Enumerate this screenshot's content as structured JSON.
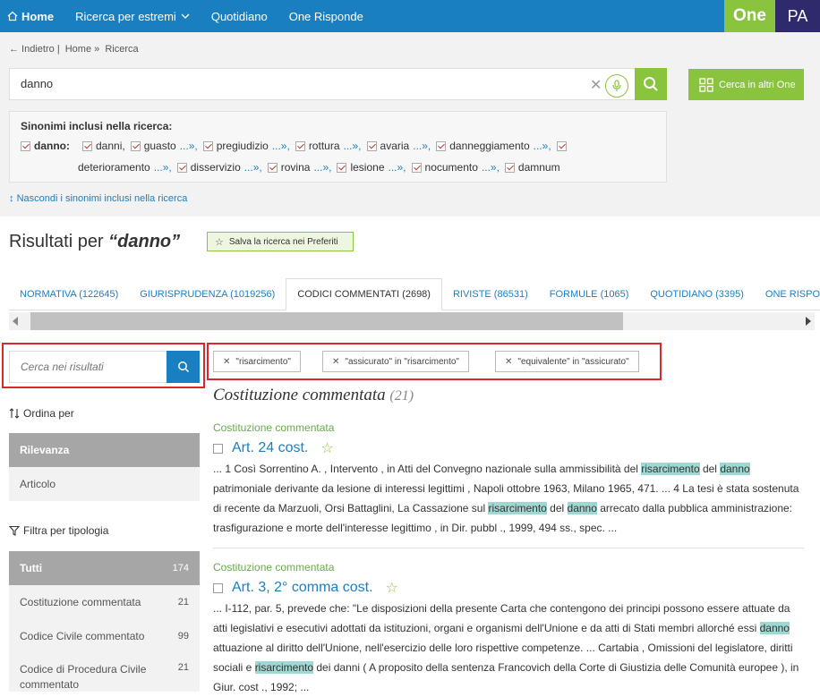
{
  "topnav": {
    "home": "Home",
    "ricerca": "Ricerca per estremi",
    "quotidiano": "Quotidiano",
    "one_risponde": "One Risponde",
    "one_badge": "One",
    "pa_badge": "PA"
  },
  "breadcrumb": {
    "back": "← Indietro",
    "sep": "|",
    "home": "Home",
    "arrow": "»",
    "current": "Ricerca"
  },
  "search": {
    "value": "danno",
    "button_altri": "Cerca in altri One"
  },
  "synonyms": {
    "title": "Sinonimi inclusi nella ricerca:",
    "term": "danno:",
    "line1": [
      "danni,",
      "guasto",
      "pregiudizio",
      "rottura",
      "avaria",
      "danneggiamento"
    ],
    "line2": [
      "deterioramento",
      "disservizio",
      "rovina",
      "lesione",
      "nocumento",
      "damnum"
    ],
    "more": "...»,",
    "hide": "Nascondi i sinonimi inclusi nella ricerca"
  },
  "results_header": {
    "prefix": "Risultati per ",
    "term": "“danno”",
    "save": "Salva la ricerca nei Preferiti"
  },
  "tabs": [
    "NORMATIVA (122645)",
    "GIURISPRUDENZA (1019256)",
    "CODICI COMMENTATI (2698)",
    "RIVISTE (86531)",
    "FORMULE (1065)",
    "QUOTIDIANO (3395)",
    "ONE RISPONDE"
  ],
  "sidebar": {
    "filter_placeholder": "Cerca nei risultati",
    "sort_label": "Ordina per",
    "sort_options": [
      "Rilevanza",
      "Articolo"
    ],
    "type_label": "Filtra per tipologia",
    "types": [
      {
        "name": "Tutti",
        "count": "174"
      },
      {
        "name": "Costituzione commentata",
        "count": "21"
      },
      {
        "name": "Codice Civile commentato",
        "count": "99"
      },
      {
        "name": "Codice di Procedura Civile commentato",
        "count": "21"
      }
    ]
  },
  "chips": [
    "\"risarcimento\"",
    "\"assicurato\" in \"risarcimento\"",
    "\"equivalente\" in \"assicurato\""
  ],
  "section": {
    "title": "Costituzione commentata",
    "count": "(21)"
  },
  "results": [
    {
      "type": "Costituzione commentata",
      "title": "Art. 24 cost.",
      "snippet_parts": [
        "... 1 Così Sorrentino A. , Intervento , in Atti del Convegno nazionale sulla ammissibilità del ",
        "risarcimento",
        " del ",
        "danno",
        " patrimoniale derivante da lesione di interessi legittimi , Napoli ottobre 1963, Milano 1965, 471. ... 4 La tesi è stata sostenuta di recente da Marzuoli, Orsi Battaglini, La Cassazione sul ",
        "risarcimento",
        " del ",
        "danno",
        " arrecato dalla pubblica amministrazione: trasfigurazione e morte dell'interesse legittimo , in Dir. pubbl ., 1999, 494 ss., spec. ..."
      ]
    },
    {
      "type": "Costituzione commentata",
      "title": "Art. 3, 2° comma cost.",
      "snippet_parts": [
        "... I-112, par. 5, prevede che: \"Le disposizioni della presente Carta che contengono dei principi possono essere attuate da atti legislativi e esecutivi adottati da istituzioni, organi e organismi dell'Unione e da atti di Stati membri allorché essi ",
        "danno",
        " attuazione al diritto dell'Unione, nell'esercizio delle loro rispettive competenze. ... Cartabia , Omissioni del legislatore, diritti sociali e ",
        "risarcimento",
        " dei danni ( A proposito della sentenza Francovich della Corte di Giustizia delle Comunità europee ), in Giur. cost ., 1992; ..."
      ]
    }
  ],
  "colors": {
    "brand_blue": "#1a7fc1",
    "brand_green": "#8ac43f",
    "pa_purple": "#2e2a6b",
    "highlight": "#9fd8d2",
    "outline_red": "#d9272e"
  }
}
